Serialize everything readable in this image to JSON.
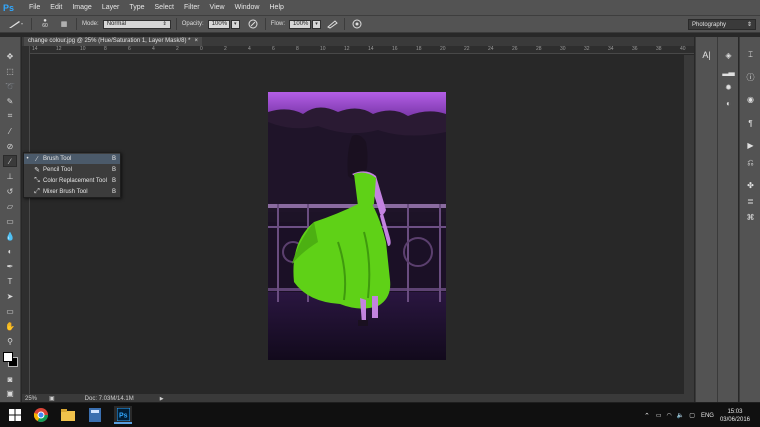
{
  "app": {
    "logo": "Ps"
  },
  "menu": [
    "File",
    "Edit",
    "Image",
    "Layer",
    "Type",
    "Select",
    "Filter",
    "View",
    "Window",
    "Help"
  ],
  "options": {
    "brush_size": "60",
    "mode_label": "Mode:",
    "mode_value": "Normal",
    "opacity_label": "Opacity:",
    "opacity_value": "100%",
    "flow_label": "Flow:",
    "flow_value": "100%",
    "workspace": "Photography"
  },
  "document": {
    "tab_title": "change colour.jpg @ 25% (Hue/Saturation 1, Layer Mask/8) *",
    "close": "×"
  },
  "ruler": {
    "ticks": [
      "14",
      "12",
      "10",
      "8",
      "6",
      "4",
      "2",
      "0",
      "2",
      "4",
      "6",
      "8",
      "10",
      "12",
      "14",
      "16",
      "18",
      "20",
      "22",
      "24",
      "26",
      "28",
      "30",
      "32",
      "34",
      "36",
      "38",
      "40"
    ]
  },
  "status": {
    "zoom": "25%",
    "doc_info": "Doc: 7.03M/14.1M"
  },
  "flyout": [
    {
      "label": "Brush Tool",
      "key": "B",
      "selected": true
    },
    {
      "label": "Pencil Tool",
      "key": "B",
      "selected": false
    },
    {
      "label": "Color Replacement Tool",
      "key": "B",
      "selected": false
    },
    {
      "label": "Mixer Brush Tool",
      "key": "B",
      "selected": false
    }
  ],
  "tray": {
    "language": "ENG",
    "time": "15:03",
    "date": "03/06/2016"
  },
  "colors": {
    "ui_panel": "#535353",
    "canvas_bg": "#282828",
    "dress": "#5fd117",
    "sky": "#9b44c9",
    "taskbar": "#101010"
  }
}
